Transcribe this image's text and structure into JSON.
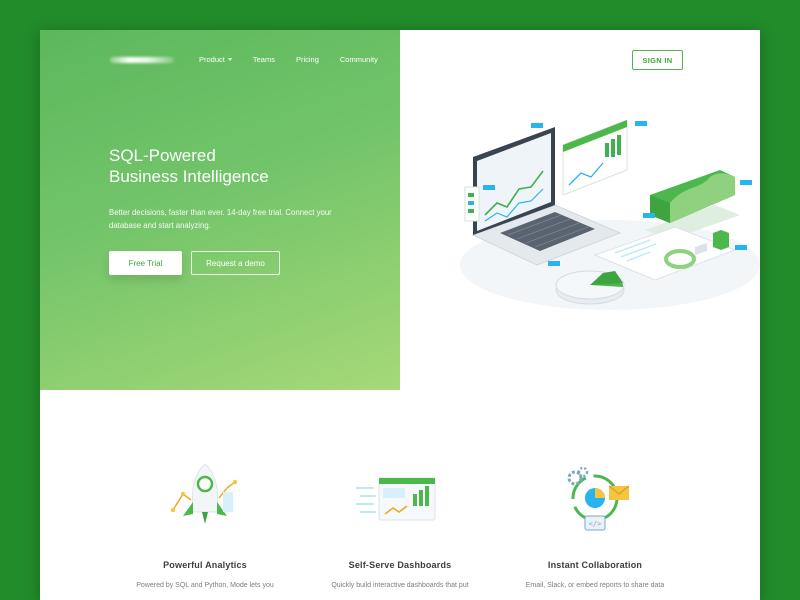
{
  "nav": {
    "items": [
      {
        "label": "Product"
      },
      {
        "label": "Teams"
      },
      {
        "label": "Pricing"
      },
      {
        "label": "Community"
      }
    ],
    "sign_in": "SIGN IN"
  },
  "hero": {
    "headline_line1": "SQL-Powered",
    "headline_line2": "Business Intelligence",
    "subtext": "Better decisions, faster than ever. 14-day free trial. Connect your database and start analyzing.",
    "primary_cta": "Free Trial",
    "secondary_cta": "Request a demo"
  },
  "features": [
    {
      "title": "Powerful Analytics",
      "desc": "Powered by SQL and Python, Mode lets you",
      "icon": "rocket-icon"
    },
    {
      "title": "Self-Serve Dashboards",
      "desc": "Quickly build interactive dashboards that put",
      "icon": "dashboard-icon"
    },
    {
      "title": "Instant Collaboration",
      "desc": "Email, Slack, or embed reports to share data",
      "icon": "collaboration-icon"
    }
  ],
  "colors": {
    "page_background": "#228b2a",
    "hero_gradient_start": "#5cb85c",
    "hero_gradient_end": "#a6d978",
    "accent": "#3fa83c",
    "illustration_blue": "#29b3f0"
  }
}
